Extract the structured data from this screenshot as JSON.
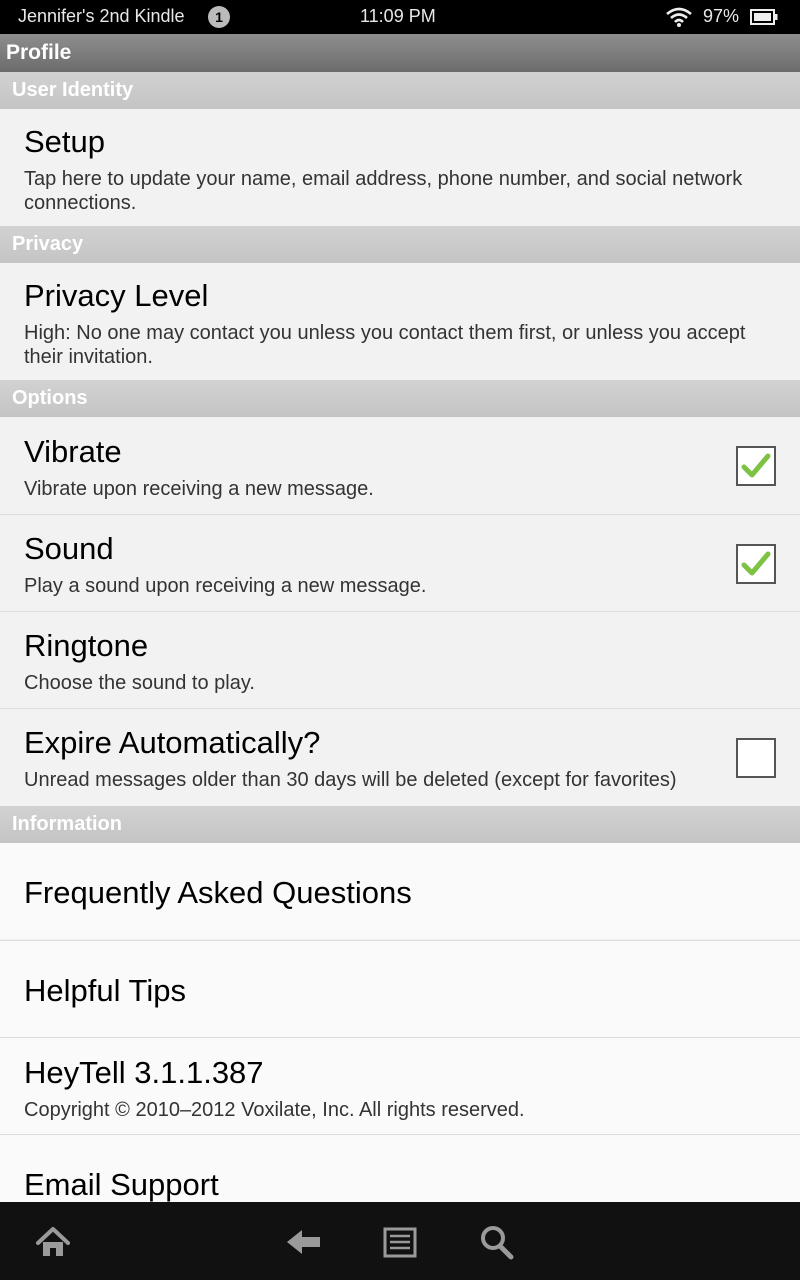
{
  "status_bar": {
    "device_name": "Jennifer's 2nd Kindle",
    "notification_count": "1",
    "time": "11:09 PM",
    "battery_percent": "97%",
    "icons": [
      "wifi-icon",
      "battery-icon"
    ]
  },
  "title": "Profile",
  "sections": {
    "user_identity": "User Identity",
    "privacy": "Privacy",
    "options": "Options",
    "information": "Information"
  },
  "rows": {
    "setup": {
      "title": "Setup",
      "subtitle": "Tap here to update your name, email address, phone number, and social network connections."
    },
    "privacy_level": {
      "title": "Privacy Level",
      "subtitle": "High: No one may contact you unless you contact them first, or unless you accept their invitation."
    },
    "vibrate": {
      "title": "Vibrate",
      "subtitle": "Vibrate upon receiving a new message.",
      "checked": true
    },
    "sound": {
      "title": "Sound",
      "subtitle": "Play a sound upon receiving a new message.",
      "checked": true
    },
    "ringtone": {
      "title": "Ringtone",
      "subtitle": "Choose the sound to play."
    },
    "expire": {
      "title": "Expire Automatically?",
      "subtitle": "Unread messages older than 30 days will be deleted (except for favorites)",
      "checked": false
    },
    "faq": {
      "title": "Frequently Asked Questions"
    },
    "tips": {
      "title": "Helpful Tips"
    },
    "version": {
      "title": "HeyTell 3.1.1.387",
      "subtitle": "Copyright © 2010–2012 Voxilate, Inc. All rights reserved."
    },
    "email_support": {
      "title": "Email Support"
    }
  },
  "nav_bar": {
    "icons": [
      "home-icon",
      "back-icon",
      "menu-icon",
      "search-icon"
    ]
  },
  "colors": {
    "check_green": "#7dc242",
    "section_header": "#c9c9c9",
    "title_bar": "#7a7a7a"
  }
}
